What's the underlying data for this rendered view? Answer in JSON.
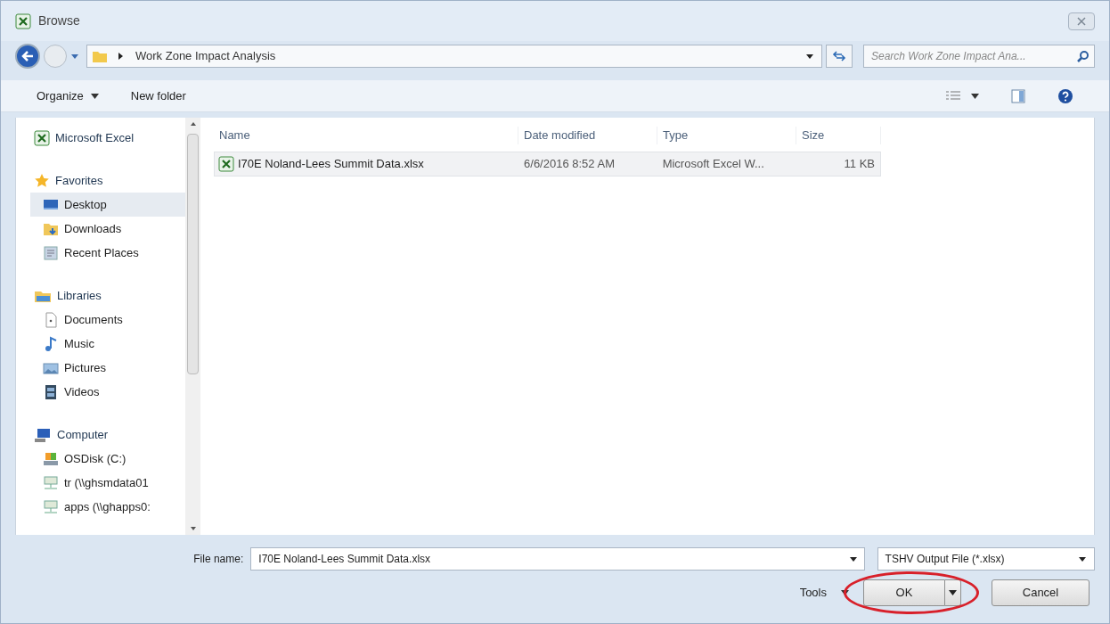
{
  "window": {
    "title": "Browse"
  },
  "address": {
    "path": "Work Zone Impact Analysis",
    "search_placeholder": "Search Work Zone Impact Ana..."
  },
  "toolbar": {
    "organize": "Organize",
    "new_folder": "New folder"
  },
  "sidebar": {
    "groups": [
      {
        "label": "Microsoft Excel"
      },
      {
        "label": "Favorites",
        "children": [
          {
            "label": "Desktop",
            "selected": true
          },
          {
            "label": "Downloads",
            "selected": false
          },
          {
            "label": "Recent Places",
            "selected": false
          }
        ]
      },
      {
        "label": "Libraries",
        "children": [
          {
            "label": "Documents",
            "selected": false
          },
          {
            "label": "Music",
            "selected": false
          },
          {
            "label": "Pictures",
            "selected": false
          },
          {
            "label": "Videos",
            "selected": false
          }
        ]
      },
      {
        "label": "Computer",
        "children": [
          {
            "label": "OSDisk (C:)",
            "selected": false
          },
          {
            "label": "tr (\\\\ghsmdata01",
            "selected": false
          },
          {
            "label": "apps (\\\\ghapps0:",
            "selected": false
          }
        ]
      }
    ]
  },
  "table": {
    "columns": [
      "Name",
      "Date modified",
      "Type",
      "Size"
    ],
    "rows": [
      {
        "name": "I70E Noland-Lees Summit Data.xlsx",
        "date": "6/6/2016 8:52 AM",
        "type": "Microsoft Excel W...",
        "size": "11 KB",
        "selected": true
      }
    ]
  },
  "footer": {
    "file_name_label": "File name:",
    "file_name": "I70E Noland-Lees Summit Data.xlsx",
    "file_type": "TSHV Output File (*.xlsx)",
    "tools": "Tools",
    "ok": "OK",
    "cancel": "Cancel",
    "ok_highlighted": true
  }
}
